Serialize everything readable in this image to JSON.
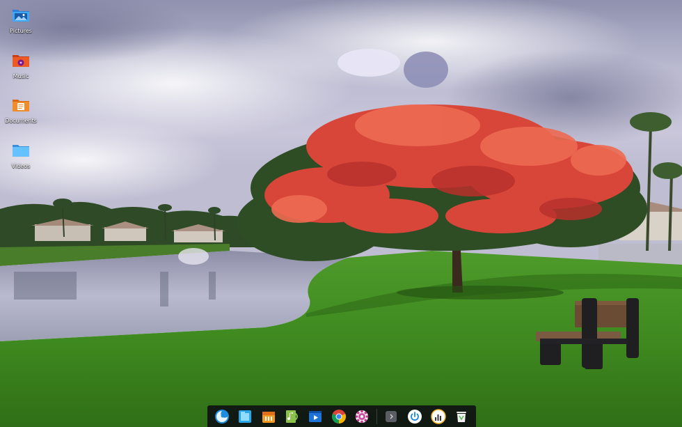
{
  "desktop": {
    "icons": [
      {
        "label": "Pictures",
        "icon": "pictures-folder-icon"
      },
      {
        "label": "Music",
        "icon": "music-folder-icon"
      },
      {
        "label": "Documents",
        "icon": "documents-folder-icon"
      },
      {
        "label": "Videos",
        "icon": "videos-folder-icon"
      }
    ]
  },
  "dock": {
    "items": [
      "launcher-icon",
      "file-manager-icon",
      "app-store-icon",
      "music-player-icon",
      "movie-player-icon",
      "chrome-icon",
      "settings-icon",
      "show-desktop-icon",
      "power-icon",
      "system-monitor-icon",
      "trash-icon"
    ]
  },
  "colors": {
    "dock_background": "#0c0e12",
    "folder_blue": "#3fa9f5",
    "folder_orange": "#ef5a24"
  }
}
